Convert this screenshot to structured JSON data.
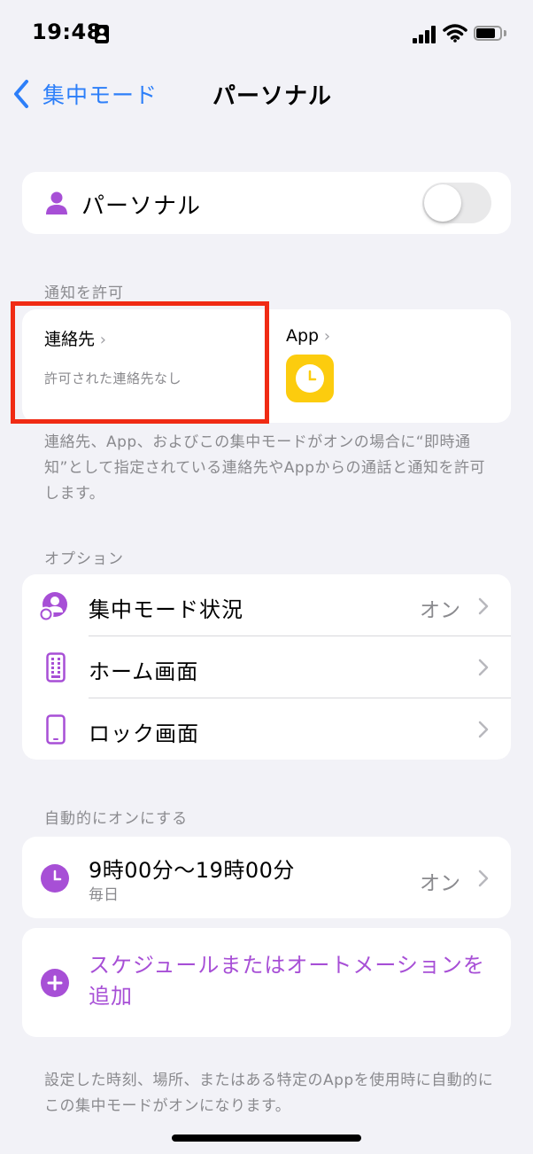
{
  "status_bar": {
    "time": "19:48"
  },
  "nav": {
    "back_label": "集中モード",
    "title": "パーソナル"
  },
  "focus_toggle": {
    "label": "パーソナル",
    "enabled": false
  },
  "allow_notifications": {
    "section_label": "通知を許可",
    "contacts": {
      "title": "連絡先",
      "subtitle": "許可された連絡先なし"
    },
    "apps": {
      "title": "App",
      "app_icons": [
        "clock-icon"
      ]
    },
    "footnote": "連絡先、App、およびこの集中モードがオンの場合に“即時通知”として指定されている連絡先やAppからの通話と通知を許可します。"
  },
  "options": {
    "section_label": "オプション",
    "items": [
      {
        "label": "集中モード状況",
        "value": "オン"
      },
      {
        "label": "ホーム画面",
        "value": ""
      },
      {
        "label": "ロック画面",
        "value": ""
      }
    ]
  },
  "automation": {
    "section_label": "自動的にオンにする",
    "schedule": {
      "time": "9時00分〜19時00分",
      "repeat": "毎日",
      "value": "オン"
    },
    "add_label": "スケジュールまたはオートメーションを追加",
    "footnote": "設定した時刻、場所、またはある特定のAppを使用時に自動的にこの集中モードがオンになります。"
  },
  "colors": {
    "accent_blue": "#2d7ff9",
    "accent_purple": "#a74fd6",
    "highlight_red": "#f02b14",
    "clock_yellow": "#fccc0e"
  }
}
